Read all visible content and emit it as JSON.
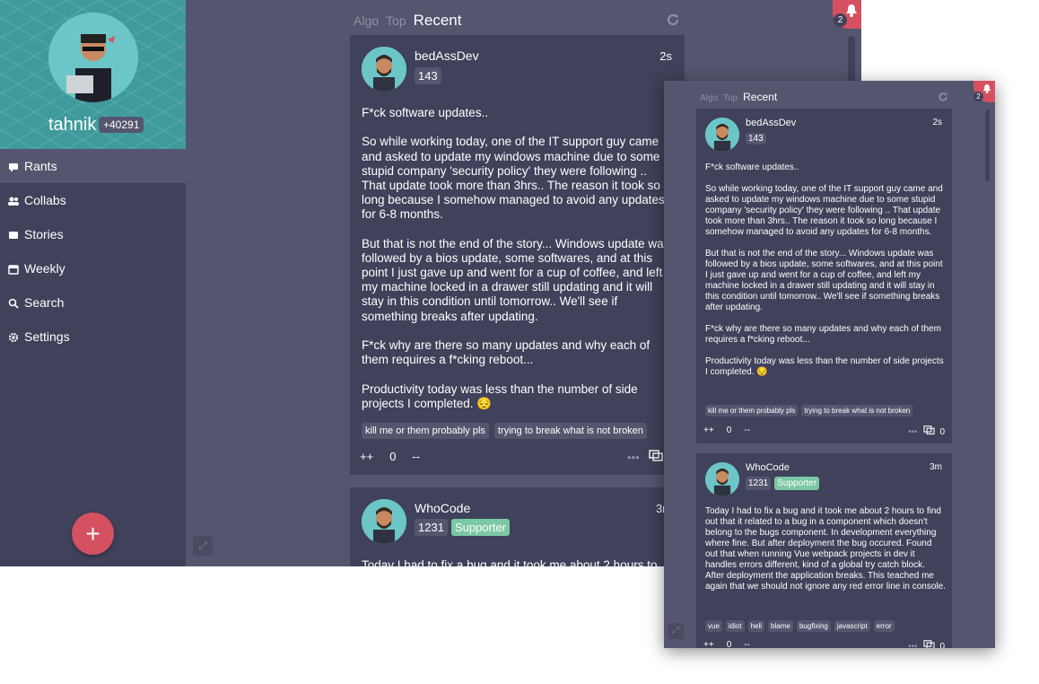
{
  "sidebar": {
    "username": "tahnik",
    "score": "+40291",
    "items": [
      {
        "label": "Rants",
        "icon": "rants-icon"
      },
      {
        "label": "Collabs",
        "icon": "collabs-icon"
      },
      {
        "label": "Stories",
        "icon": "stories-icon"
      },
      {
        "label": "Weekly",
        "icon": "weekly-icon"
      },
      {
        "label": "Search",
        "icon": "search-icon"
      },
      {
        "label": "Settings",
        "icon": "gear-icon"
      }
    ],
    "fab": "+"
  },
  "feed": {
    "tabs": [
      "Algo",
      "Top",
      "Recent"
    ],
    "notifications": "2"
  },
  "posts": [
    {
      "user": "bedAssDev",
      "score": "143",
      "time": "2s",
      "paragraphs": [
        "F*ck software updates..",
        "So while working today, one of the IT support guy came and asked to update my windows machine due to some stupid company 'security policy' they were following .. That update took more than 3hrs.. The reason it took so long because I somehow managed to avoid any updates for 6-8 months.",
        "But that is not the end of the story... Windows update was followed by a bios update, some softwares, and at this point I just gave up and went for a cup of coffee, and left my machine locked in a drawer still updating and it will stay in this condition until tomorrow.. We'll see if something breaks after updating.",
        "F*ck why are there so many updates and why each of them requires a f*cking reboot...",
        "Productivity today was less than the number of side projects I completed. 😔"
      ],
      "tags": [
        "kill me or them probably pls",
        "trying to break what is not broken"
      ],
      "upvote": "++",
      "votes": "0",
      "downvote": "--",
      "comments": "0"
    },
    {
      "user": "WhoCode",
      "score": "1231",
      "supporter": "Supporter",
      "time": "3m",
      "paragraphs": [
        "Today I had to fix a bug and it took me about 2 hours to find out that it related to a bug in a component which doesn't belong to the bugs component. In development everything where fine. But after deployment the bug occured. Found out that when running Vue webpack projects in dev it handles errors different, kind of a global try catch block. After deployment the application breaks. This teached me again that we should not ignore any red error line in console."
      ],
      "tags": [
        "vue",
        "idiot",
        "hell",
        "blame",
        "bugfixing",
        "javascript",
        "error"
      ],
      "upvote": "++",
      "votes": "0",
      "downvote": "--",
      "comments": "0"
    }
  ],
  "colors": {
    "background": "#54556e",
    "card": "#40415a",
    "accent": "#d55161",
    "avatar": "#6cc5c6",
    "supporter": "#7bc8a4"
  }
}
